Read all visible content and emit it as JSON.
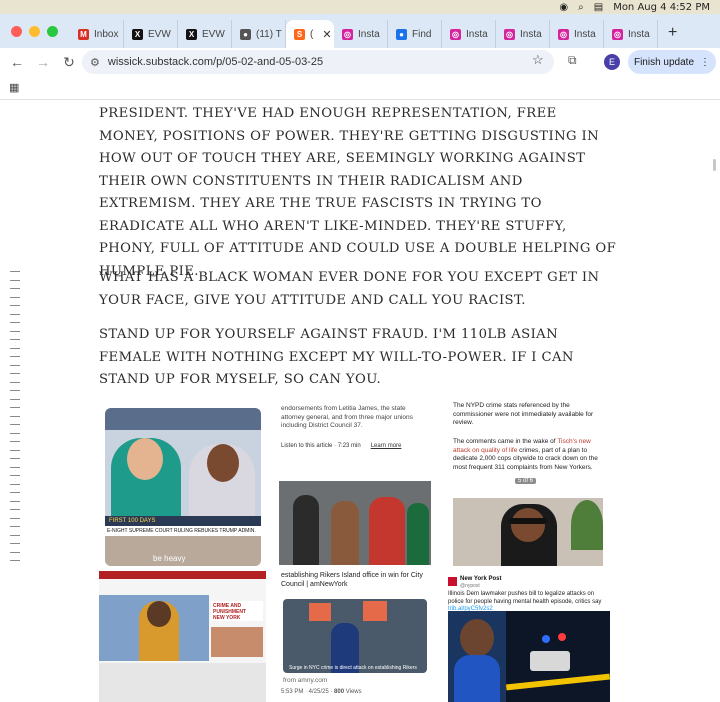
{
  "menubar": {
    "datetime": "Mon Aug 4  4:52 PM"
  },
  "tabs": [
    {
      "label": "Inbox",
      "color": "#d93025",
      "glyph": "M"
    },
    {
      "label": "EVW",
      "color": "#111111",
      "glyph": "X"
    },
    {
      "label": "EVW",
      "color": "#111111",
      "glyph": "X"
    },
    {
      "label": "(11) T",
      "color": "#555555",
      "glyph": "●"
    },
    {
      "label": "(",
      "color": "#ff6719",
      "glyph": "S",
      "active": true
    },
    {
      "label": "Insta",
      "color": "#d6249f",
      "glyph": "◎"
    },
    {
      "label": "Find",
      "color": "#1a73e8",
      "glyph": "●"
    },
    {
      "label": "Insta",
      "color": "#d6249f",
      "glyph": "◎"
    },
    {
      "label": "Insta",
      "color": "#d6249f",
      "glyph": "◎"
    },
    {
      "label": "Insta",
      "color": "#d6249f",
      "glyph": "◎"
    },
    {
      "label": "Insta",
      "color": "#d6249f",
      "glyph": "◎"
    }
  ],
  "toolbar": {
    "url": "wissick.substack.com/p/05-02-and-05-03-25",
    "avatar_letter": "E",
    "finish_label": "Finish update"
  },
  "article": {
    "p1": "President. They've had enough representation, free money, positions of power. They're getting disgusting in how out of touch they are, seemingly working against their own constituents in their radicalism and extremism. They are the true fascists in trying to eradicate all who aren't like-minded. They're stuffy, phony, full of attitude and could use a double helping of humple pie.",
    "p2": "What has a black woman ever done for you except get in your face, give you attitude and call you racist.",
    "p3": "Stand up for yourself against fraud. I'm 110lb Asian female with nothing except my will-to-power. If I can stand up for myself, so can you."
  },
  "collage": {
    "tv_chyron_top": "FIRST 100 DAYS",
    "tv_chyron": "E-NIGHT SUPREME COURT RULING REBUKES TRUMP ADMIN.",
    "tv_overlay": "be heavy",
    "article_top": "endorsements from Letitia James, the state attorney general, and from three major unions including District Council 37.",
    "article_listen": "Listen to this article · 7:23 min",
    "article_learn": "Learn more",
    "article_bottom": "establishing Rikers Island office in win for City Council | amNewYork",
    "nypd_text_a": "The NYPD crime stats referenced by the commissioner were not immediately available for review.",
    "nypd_text_b": "The comments came in the wake of",
    "nypd_link": "Tisch's new attack on quality of life",
    "nypd_text_c": "crimes, part of a plan to dedicate 2,000 cops citywide to crack down on the most frequent 311 complaints from New Yorkers.",
    "nypd_counter": "5 of 6",
    "rally_caption": "Surge in NYC crime is direct attack on establishing Rikers",
    "rally_source": "from amny.com",
    "tweet_meta_time": "5:53 PM · 4/25/25 · ",
    "tweet_meta_views": "800",
    "tweet_meta_label": " Views",
    "nypost_name": "New York Post",
    "nypost_handle": "@nypost",
    "nypost_text": "Illinois Dem lawmaker pushes bill to legalize attacks on police for people having mental health episode, critics say",
    "nypost_link": "trib.al/pyC5fv2s2",
    "crime_header": "CRIME AND PUNISHMENT",
    "crime_sub": "NEW YORK"
  }
}
